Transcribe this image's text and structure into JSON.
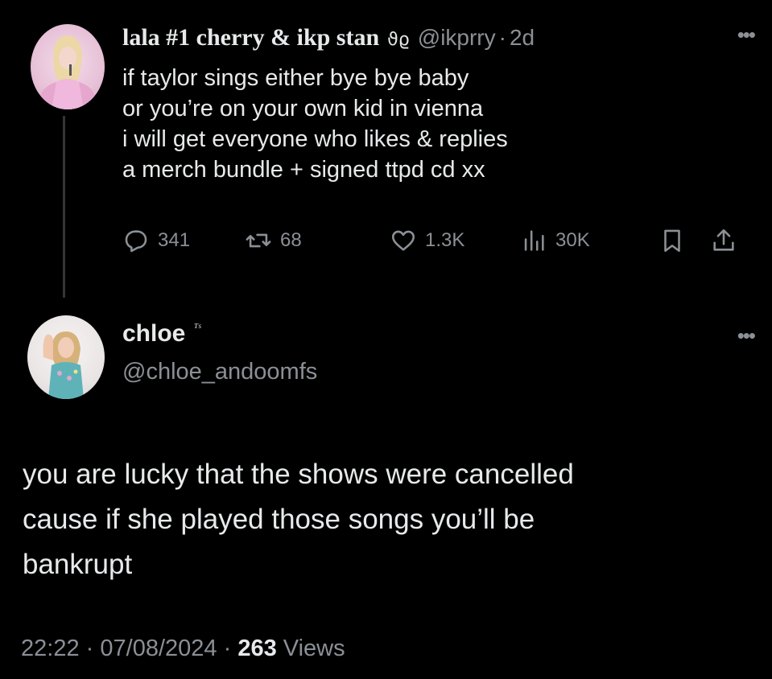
{
  "tweet": {
    "author_name": "lala #1 cherry & ikp stan",
    "author_glyph": "ϑϱ",
    "handle": "@ikprry",
    "separator": "·",
    "time": "2d",
    "more_icon": "more-horizontal-icon",
    "lines": [
      "if taylor sings either bye bye baby",
      "or you’re on your own kid in vienna",
      "i will get everyone who likes & replies",
      "a merch bundle + signed ttpd cd xx"
    ],
    "actions": {
      "replies": "341",
      "reposts": "68",
      "likes": "1.3K",
      "views": "30K"
    }
  },
  "reply": {
    "author_name": "chloe",
    "author_badge": "ᵀˢ",
    "handle": "@chloe_andoomfs",
    "lines": [
      "you are lucky that the shows were cancelled",
      "cause if she played those songs you’ll be",
      "bankrupt"
    ],
    "time": "22:22",
    "date": "07/08/2024",
    "views_count": "263",
    "views_label": "Views",
    "separator": "·"
  },
  "colors": {
    "background": "#000000",
    "primary_text": "#e7e9ea",
    "secondary_text": "#8b9096",
    "thread_line": "#333639"
  }
}
